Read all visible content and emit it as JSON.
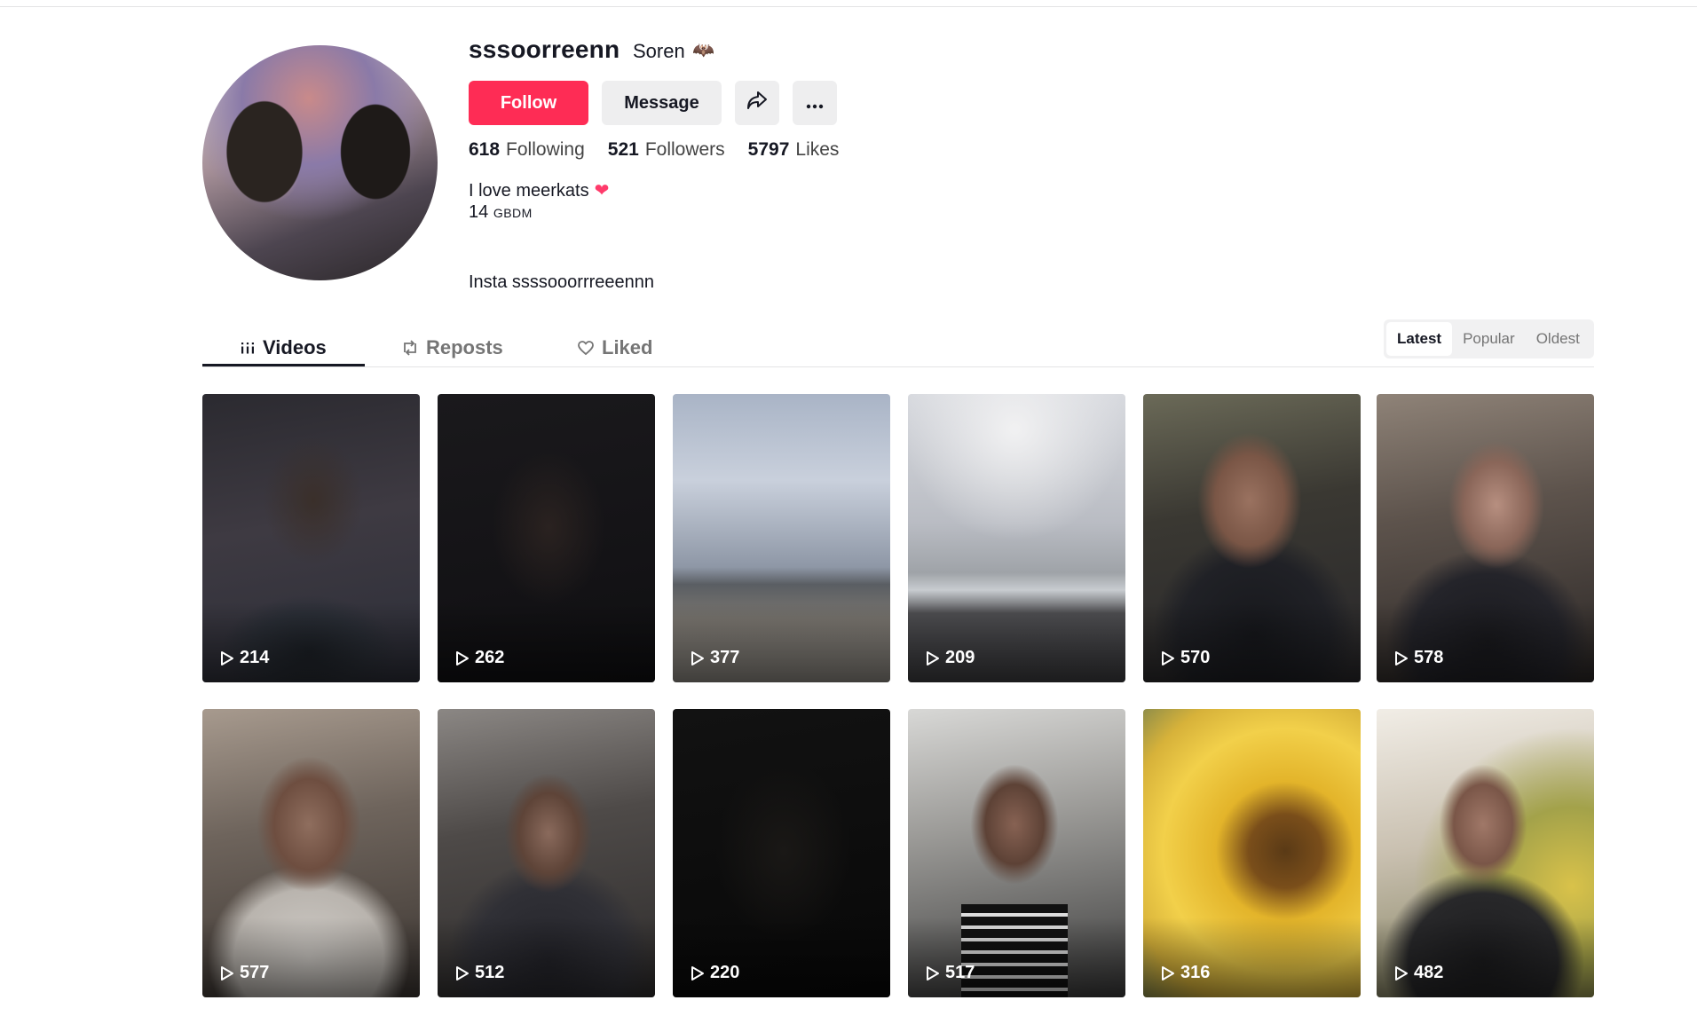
{
  "profile": {
    "username": "sssoorreenn",
    "nickname": "Soren",
    "nickname_emoji": "🦇",
    "follow_label": "Follow",
    "message_label": "Message",
    "stats": [
      {
        "value": "618",
        "label": "Following"
      },
      {
        "value": "521",
        "label": "Followers"
      },
      {
        "value": "5797",
        "label": "Likes"
      }
    ],
    "bio_line1": "I love meerkats",
    "bio_heart": "❤",
    "bio_line2_num": "14",
    "bio_line2_tag": "GBDM",
    "bio_line3": "Insta ssssooorrreeennn"
  },
  "tabs": [
    {
      "label": "Videos",
      "icon": "grid-icon",
      "active": true
    },
    {
      "label": "Reposts",
      "icon": "repost-icon",
      "active": false
    },
    {
      "label": "Liked",
      "icon": "heart-outline-icon",
      "active": false
    }
  ],
  "sort": {
    "options": [
      "Latest",
      "Popular",
      "Oldest"
    ],
    "selected": "Latest"
  },
  "videos": [
    {
      "views": "214"
    },
    {
      "views": "262"
    },
    {
      "views": "377"
    },
    {
      "views": "209"
    },
    {
      "views": "570"
    },
    {
      "views": "578"
    },
    {
      "views": "577"
    },
    {
      "views": "512"
    },
    {
      "views": "220"
    },
    {
      "views": "517"
    },
    {
      "views": "316"
    },
    {
      "views": "482"
    }
  ],
  "colors": {
    "accent": "#fe2c55",
    "text_primary": "#161823",
    "button_secondary": "#eeeeef"
  }
}
